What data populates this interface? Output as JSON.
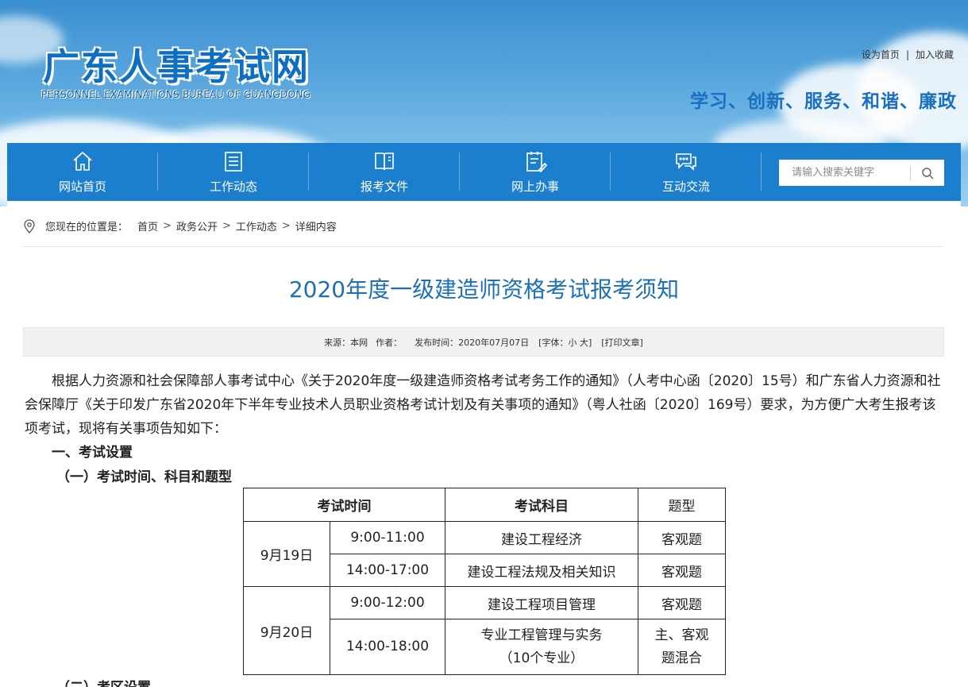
{
  "header": {
    "title": "广东人事考试网",
    "subtitle": "PERSONNEL EXAMINATIONS BUREAU OF GUANGDONG",
    "top_links": [
      "设为首页",
      "|",
      "加入收藏"
    ],
    "slogan": "学习、创新、服务、和谐、廉政"
  },
  "nav": {
    "items": [
      {
        "label": "网站首页",
        "icon": "home-icon"
      },
      {
        "label": "工作动态",
        "icon": "list-icon"
      },
      {
        "label": "报考文件",
        "icon": "book-icon"
      },
      {
        "label": "网上办事",
        "icon": "clipboard-edit-icon"
      },
      {
        "label": "互动交流",
        "icon": "chat-icon"
      }
    ],
    "search_placeholder": "请输入搜索关键字"
  },
  "breadcrumb": {
    "prefix": "您现在的位置是：",
    "items": [
      "首页",
      "政务公开",
      "工作动态",
      "详细内容"
    ],
    "separator": ">"
  },
  "article": {
    "title": "2020年度一级建造师资格考试报考须知",
    "meta": {
      "source": "来源：本网",
      "author": "作者：",
      "date": "发布时间：2020年07月07日",
      "font": "[字体：小 大]",
      "print": "[打印文章]"
    },
    "intro": "根据人力资源和社会保障部人事考试中心《关于2020年度一级建造师资格考试考务工作的通知》（人考中心函〔2020〕15号）和广东省人力资源和社会保障厅《关于印发广东省2020年下半年专业技术人员职业资格考试计划及有关事项的通知》（粤人社函〔2020〕169号）要求，为方便广大考生报考该项考试，现将有关事项告知如下：",
    "section1": "一、考试设置",
    "section1_1": "（一）考试时间、科目和题型",
    "section1_2": "（二）考区设置"
  },
  "table": {
    "headers": [
      "考试时间",
      "考试科目",
      "题型"
    ],
    "rows": [
      {
        "date": "9月19日",
        "time": "9:00-11:00",
        "subject": "建设工程经济",
        "type": "客观题"
      },
      {
        "date": "9月19日",
        "time": "14:00-17:00",
        "subject": "建设工程法规及相关知识",
        "type": "客观题"
      },
      {
        "date": "9月20日",
        "time": "9:00-12:00",
        "subject": "建设工程项目管理",
        "type": "客观题"
      },
      {
        "date": "9月20日",
        "time": "14:00-18:00",
        "subject": "专业工程管理与实务（10个专业）",
        "type": "主、客观题混合"
      }
    ]
  },
  "colors": {
    "nav_bg": "#1b7fcd",
    "title_blue": "#1d6fb8",
    "logo_blue": "#0e6ec2"
  }
}
